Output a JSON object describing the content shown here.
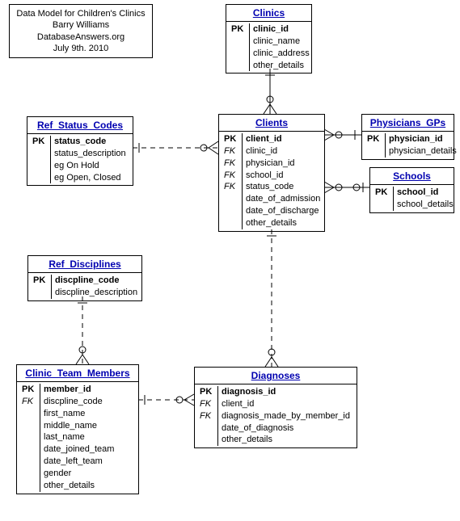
{
  "title": {
    "line1": "Data Model for Children's Clinics",
    "line2": "Barry Williams",
    "line3": "DatabaseAnswers.org",
    "line4": "July 9th. 2010"
  },
  "entities": {
    "clinics": {
      "name": "Clinics",
      "rows": [
        {
          "key": "PK",
          "attr": "clinic_id",
          "pk": true
        },
        {
          "key": "",
          "attr": "clinic_name"
        },
        {
          "key": "",
          "attr": "clinic_address"
        },
        {
          "key": "",
          "attr": "other_details"
        }
      ]
    },
    "clients": {
      "name": "Clients",
      "rows": [
        {
          "key": "PK",
          "attr": "client_id",
          "pk": true
        },
        {
          "key": "FK",
          "attr": "clinic_id",
          "fk": true
        },
        {
          "key": "FK",
          "attr": "physician_id",
          "fk": true
        },
        {
          "key": "FK",
          "attr": "school_id",
          "fk": true
        },
        {
          "key": "FK",
          "attr": "status_code",
          "fk": true
        },
        {
          "key": "",
          "attr": "date_of_admission"
        },
        {
          "key": "",
          "attr": "date_of_discharge"
        },
        {
          "key": "",
          "attr": "other_details"
        }
      ]
    },
    "physicians": {
      "name": "Physicians_GPs",
      "rows": [
        {
          "key": "PK",
          "attr": "physician_id",
          "pk": true
        },
        {
          "key": "",
          "attr": "physician_details"
        }
      ]
    },
    "schools": {
      "name": "Schools",
      "rows": [
        {
          "key": "PK",
          "attr": "school_id",
          "pk": true
        },
        {
          "key": "",
          "attr": "school_details"
        }
      ]
    },
    "ref_status": {
      "name": "Ref_Status_Codes",
      "rows": [
        {
          "key": "PK",
          "attr": "status_code",
          "pk": true
        },
        {
          "key": "",
          "attr": "status_description"
        },
        {
          "key": "",
          "attr": "eg On Hold"
        },
        {
          "key": "",
          "attr": "eg Open, Closed"
        }
      ]
    },
    "ref_disciplines": {
      "name": "Ref_Disciplines",
      "rows": [
        {
          "key": "PK",
          "attr": "discpline_code",
          "pk": true
        },
        {
          "key": "",
          "attr": "discpline_description"
        }
      ]
    },
    "team_members": {
      "name": "Clinic_Team_Members",
      "rows": [
        {
          "key": "PK",
          "attr": "member_id",
          "pk": true
        },
        {
          "key": "FK",
          "attr": "discpline_code",
          "fk": true
        },
        {
          "key": "",
          "attr": "first_name"
        },
        {
          "key": "",
          "attr": "middle_name"
        },
        {
          "key": "",
          "attr": "last_name"
        },
        {
          "key": "",
          "attr": "date_joined_team"
        },
        {
          "key": "",
          "attr": "date_left_team"
        },
        {
          "key": "",
          "attr": "gender"
        },
        {
          "key": "",
          "attr": "other_details"
        }
      ]
    },
    "diagnoses": {
      "name": "Diagnoses",
      "rows": [
        {
          "key": "PK",
          "attr": "diagnosis_id",
          "pk": true
        },
        {
          "key": "FK",
          "attr": "client_id",
          "fk": true
        },
        {
          "key": "FK",
          "attr": "diagnosis_made_by_member_id",
          "fk": true
        },
        {
          "key": "",
          "attr": "date_of_diagnosis"
        },
        {
          "key": "",
          "attr": "other_details"
        }
      ]
    }
  }
}
